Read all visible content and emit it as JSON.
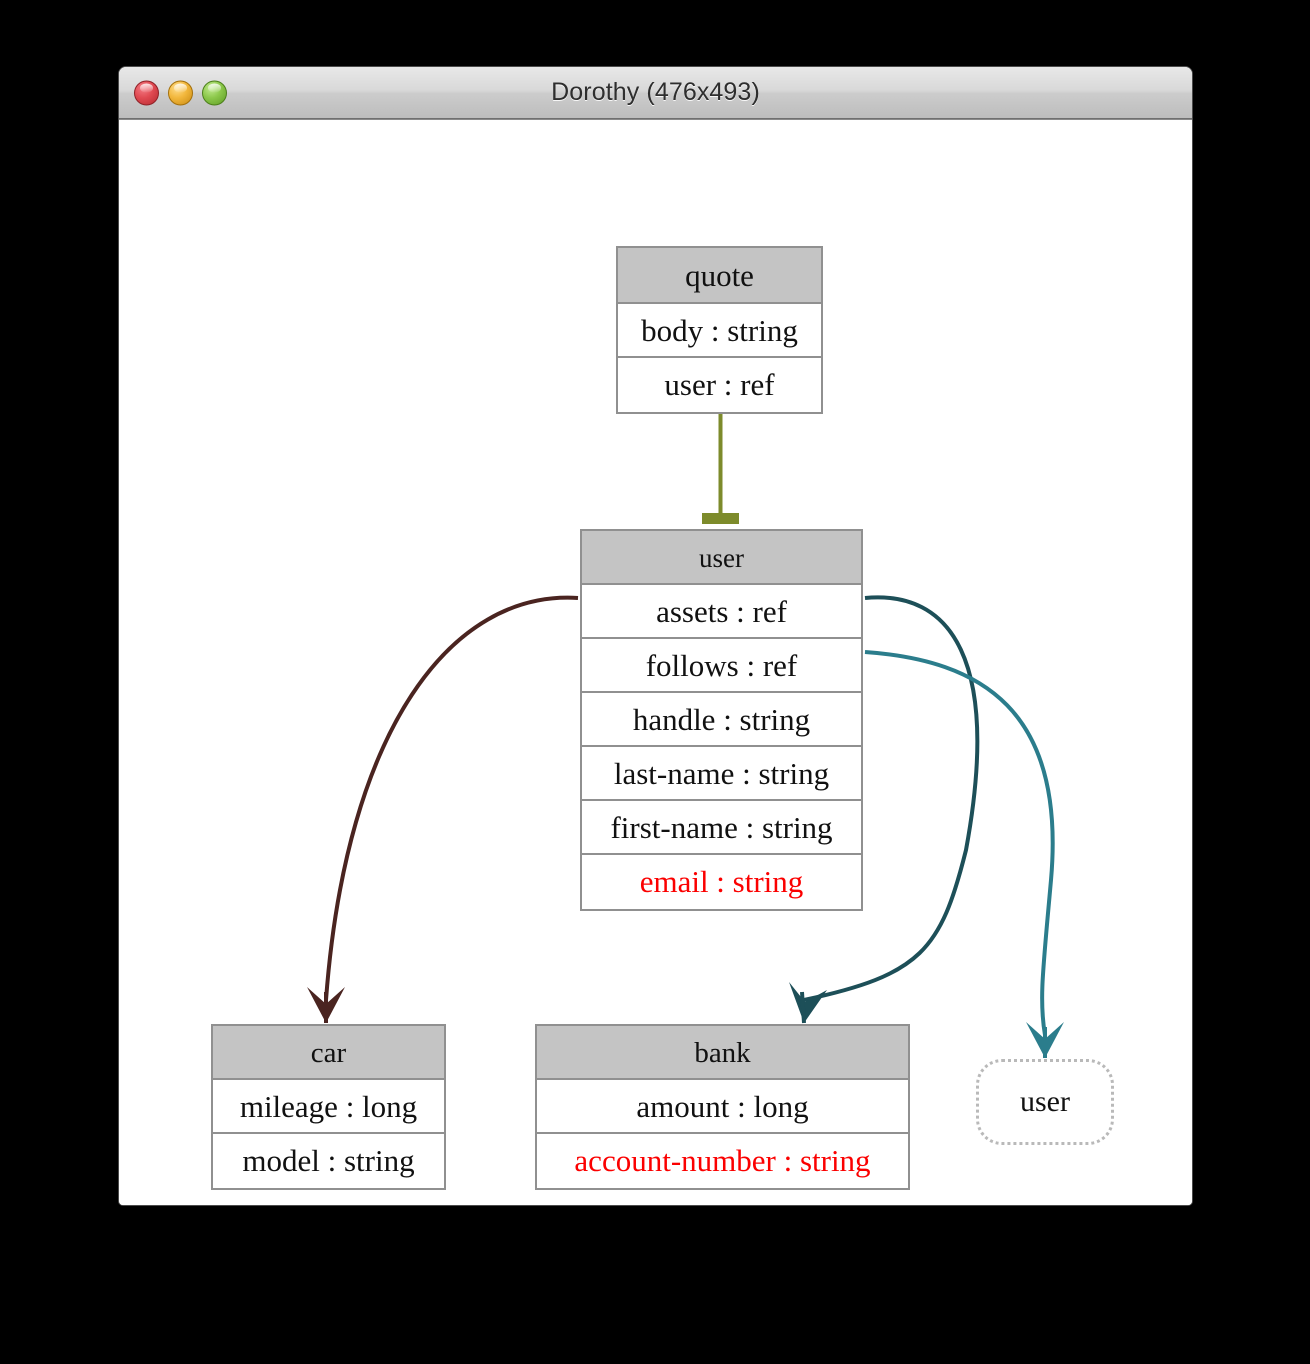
{
  "window": {
    "title": "Dorothy (476x493)",
    "controls": [
      {
        "name": "close",
        "label": "Close"
      },
      {
        "name": "minimize",
        "label": "Minimize"
      },
      {
        "name": "zoom",
        "label": "Zoom"
      }
    ]
  },
  "diagram": {
    "type": "entity-relationship-schema",
    "nodes": [
      {
        "id": "quote",
        "title": "quote",
        "style": "solid",
        "fields": [
          {
            "text": "body : string",
            "color": "#111111"
          },
          {
            "text": "user : ref",
            "color": "#111111"
          }
        ]
      },
      {
        "id": "user",
        "title": "user",
        "style": "solid",
        "fields": [
          {
            "text": "assets : ref",
            "color": "#111111"
          },
          {
            "text": "follows : ref",
            "color": "#111111"
          },
          {
            "text": "handle : string",
            "color": "#111111"
          },
          {
            "text": "last-name : string",
            "color": "#111111"
          },
          {
            "text": "first-name : string",
            "color": "#111111"
          },
          {
            "text": "email : string",
            "color": "#fb0000"
          }
        ]
      },
      {
        "id": "car",
        "title": "car",
        "style": "solid",
        "fields": [
          {
            "text": "mileage : long",
            "color": "#111111"
          },
          {
            "text": "model : string",
            "color": "#111111"
          }
        ]
      },
      {
        "id": "bank",
        "title": "bank",
        "style": "solid",
        "fields": [
          {
            "text": "amount : long",
            "color": "#111111"
          },
          {
            "text": "account-number : string",
            "color": "#fb0000"
          }
        ]
      },
      {
        "id": "user-ghost",
        "title": "user",
        "style": "dotted",
        "fields": []
      }
    ],
    "edges": [
      {
        "id": "quote-user",
        "from": "quote.user : ref",
        "to": "user",
        "color": "#7d8b2b",
        "marker": "tee"
      },
      {
        "id": "user-car",
        "from": "user.assets : ref",
        "to": "car",
        "color": "#4a2420",
        "marker": "arrow"
      },
      {
        "id": "user-bank",
        "from": "user.assets : ref",
        "to": "bank",
        "color": "#1d4f58",
        "marker": "arrow"
      },
      {
        "id": "user-follows",
        "from": "user.follows : ref",
        "to": "user-ghost",
        "color": "#2b7d8c",
        "marker": "arrow"
      }
    ]
  },
  "colors": {
    "box_header": "#c4c4c4",
    "box_border": "#909090",
    "required_field": "#fb0000",
    "canvas": "#ffffff",
    "edge_olive": "#7d8b2b",
    "edge_brown": "#4a2420",
    "edge_teal_dark": "#1d4f58",
    "edge_teal_light": "#2b7d8c"
  }
}
